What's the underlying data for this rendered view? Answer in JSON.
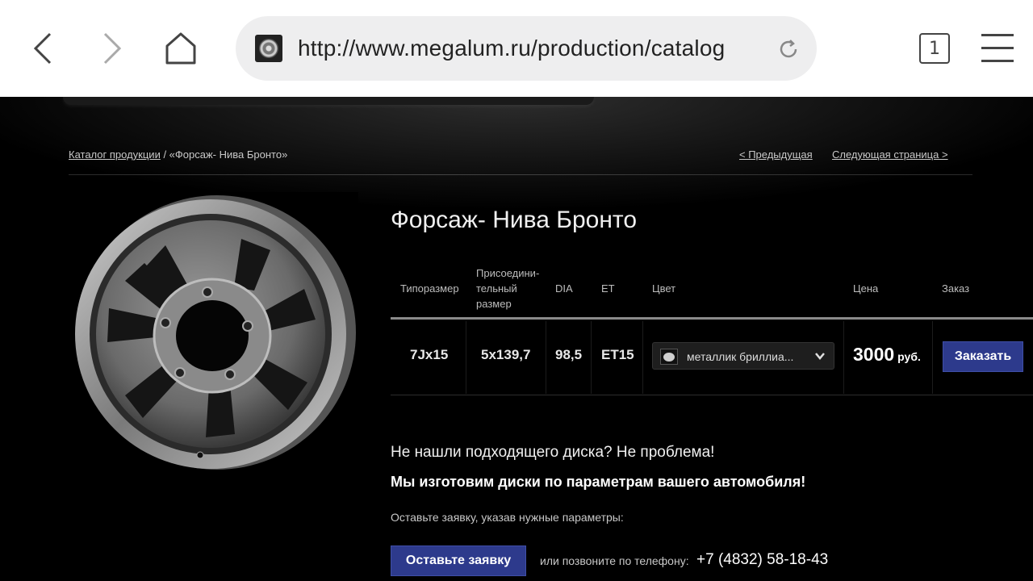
{
  "browser": {
    "url": "http://www.megalum.ru/production/catalog",
    "tab_count": "1",
    "icons": {
      "back": "back-arrow-icon",
      "forward": "forward-arrow-icon",
      "home": "home-icon",
      "reload": "reload-icon",
      "tabs": "tabs-icon",
      "menu": "hamburger-menu-icon"
    }
  },
  "breadcrumb": {
    "catalog_link": "Каталог продукции",
    "separator": " / ",
    "current": "«Форсаж- Нива Бронто»"
  },
  "pager": {
    "prev": "< Предыдущая",
    "next": "Следующая страница >"
  },
  "product": {
    "title": "Форсаж- Нива Бронто",
    "image_alt": "wheel-image"
  },
  "table": {
    "headers": {
      "size": "Типоразмер",
      "pcd_line1": "Присоедини-",
      "pcd_line2": "тельный",
      "pcd_line3": "размер",
      "dia": "DIA",
      "et": "ET",
      "color": "Цвет",
      "price": "Цена",
      "order": "Заказ"
    },
    "row": {
      "size": "7Jx15",
      "pcd": "5x139,7",
      "dia": "98,5",
      "et": "ET15",
      "color": "металлик бриллиа...",
      "price": "3000",
      "currency": "руб.",
      "order_button": "Заказать"
    }
  },
  "promo": {
    "line1": "Не нашли подходящего диска? Не проблема!",
    "line2": "Мы изготовим диски по параметрам вашего автомобиля!",
    "line3": "Оставьте заявку, указав нужные параметры:",
    "request_button": "Оставьте заявку",
    "call_text": "или позвоните по телефону:",
    "phone": "+7 (4832) 58-18-43"
  },
  "colors": {
    "accent_button": "#2d3a8c",
    "page_bg": "#000000"
  }
}
